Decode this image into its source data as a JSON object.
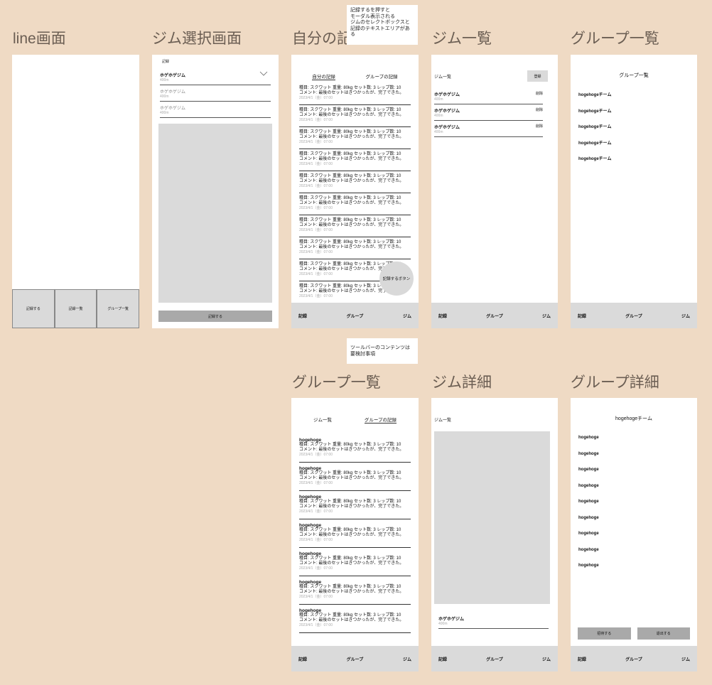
{
  "screens": {
    "line": {
      "title": "line画面",
      "buttons": [
        "記録する",
        "記録一覧",
        "グループ一覧"
      ]
    },
    "gym_select": {
      "title": "ジム選択画面",
      "label": "記録",
      "gyms": [
        {
          "name": "ホゲホゲジム",
          "dist": "400m"
        },
        {
          "name": "ホゲホゲジム",
          "dist": "400m"
        },
        {
          "name": "ホゲホゲジム",
          "dist": "400m"
        }
      ],
      "submit": "記録する"
    },
    "my_records": {
      "title": "自分の記録",
      "tabs": [
        "自分の記録",
        "グループの記録"
      ],
      "fab": "記録するボタン"
    },
    "gym_list": {
      "title": "ジム一覧",
      "header": "ジム一覧",
      "register": "登録",
      "gyms": [
        {
          "name": "ホゲホゲジム",
          "dist": "400m",
          "action": "削除"
        },
        {
          "name": "ホゲホゲジム",
          "dist": "400m",
          "action": "削除"
        },
        {
          "name": "ホゲホゲジム",
          "dist": "400m",
          "action": "削除"
        }
      ]
    },
    "group_list": {
      "title": "グループ一覧",
      "header": "グループ一覧",
      "teams": [
        "hogehogeチーム",
        "hogehogeチーム",
        "hogehogeチーム",
        "hogehogeチーム",
        "hogehogeチーム"
      ]
    },
    "group_records": {
      "title": "グループ一覧",
      "tabs": [
        "ジム一覧",
        "グループの記録"
      ],
      "author": "hogehoge"
    },
    "gym_detail": {
      "title": "ジム詳細",
      "header": "ジム一覧",
      "gym": {
        "name": "ホゲホゲジム",
        "dist": "400m"
      }
    },
    "group_detail": {
      "title": "グループ詳細",
      "header": "hogehogeチーム",
      "members": [
        "hogehoge",
        "hogehoge",
        "hogehoge",
        "hogehoge",
        "hogehoge",
        "hogehoge",
        "hogehoge",
        "hogehoge",
        "hogehoge"
      ],
      "buttons": [
        "招待する",
        "退出する"
      ]
    }
  },
  "record": {
    "line1": "種目: スクワット 重量: 80kg セット数: 3 レップ数: 10",
    "line2": "コメント: 最後のセットはきつかったが、完了できた。",
    "date": "2023/4/1（金）07:00"
  },
  "tabbar": [
    "記録",
    "グループ",
    "ジム"
  ],
  "notes": {
    "modal": "記録するを押すと\nモーダル表示される\nジムのセレクトボックスと\n記録のテキストエリアがある",
    "toolbar": "ツールバーのコンテンツは\n要検討事項"
  },
  "colors": {
    "background": "#efdac4",
    "placeholder": "#dadada",
    "title": "#6b5e53"
  }
}
